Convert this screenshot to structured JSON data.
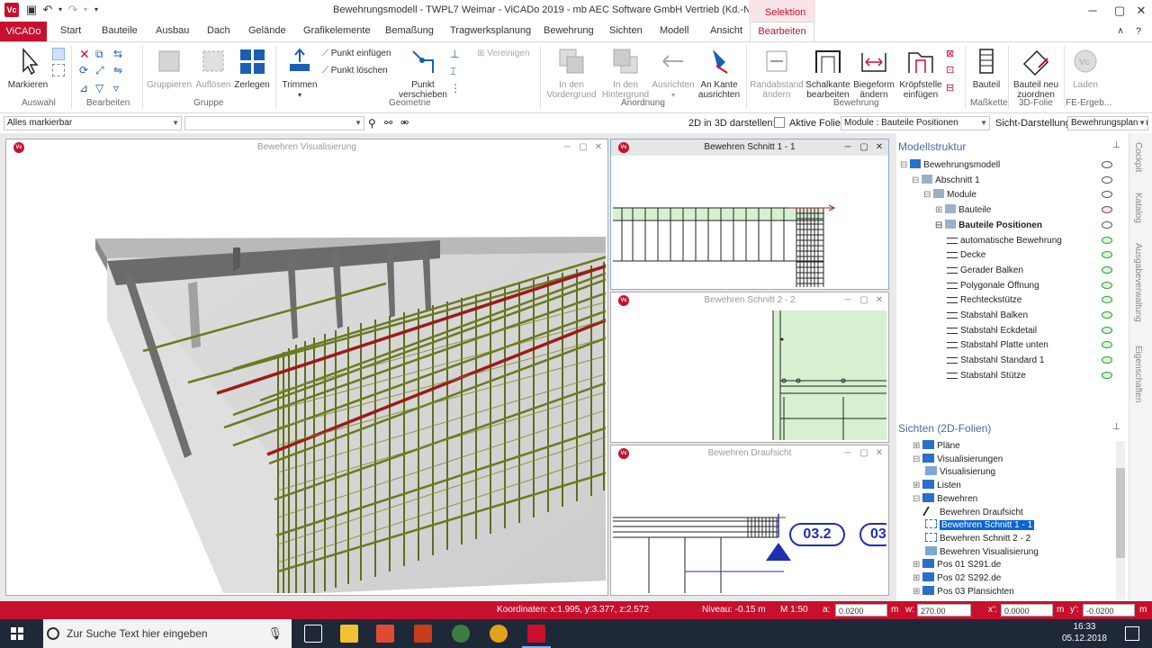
{
  "window": {
    "title": "Bewehrungsmodell - TWPL7 Weimar - ViCADo 2019 - mb AEC Software GmbH Vertrieb (Kd.-Nr. 60000)",
    "context_tab": "Selektion",
    "app_logo": "Vc"
  },
  "ribbon_tabs": [
    "ViCADo",
    "Start",
    "Bauteile",
    "Ausbau",
    "Dach",
    "Gelände",
    "Grafikelemente",
    "Bemaßung",
    "Tragwerksplanung",
    "Bewehrung",
    "Sichten",
    "Modell",
    "Ansicht",
    "Bearbeiten"
  ],
  "ribbon": {
    "groups": {
      "auswahl": "Auswahl",
      "bearbeiten": "Bearbeiten",
      "gruppe": "Gruppe",
      "geometrie": "Geometrie",
      "anordnung": "Anordnung",
      "bewehrung": "Bewehrung",
      "masskette": "Maßkette",
      "folie3d": "3D-Folie",
      "fe": "FE-Ergeb..."
    },
    "markieren": "Markieren",
    "gruppieren": "Gruppieren",
    "aufloesen": "Auflösen",
    "zerlegen": "Zerlegen",
    "trimmen": "Trimmen",
    "punkt_einfuegen": "Punkt einfügen",
    "punkt_loeschen": "Punkt löschen",
    "punkt_verschieben": [
      "Punkt",
      "verschieben"
    ],
    "vereinigen": "Vereinigen",
    "in_den_vordergrund": [
      "In den",
      "Vordergrund"
    ],
    "in_den_hintergrund": [
      "In den",
      "Hintergrund"
    ],
    "ausrichten": "Ausrichten",
    "an_kante_ausrichten": [
      "An Kante",
      "ausrichten"
    ],
    "randabstand_aendern": [
      "Randabstand",
      "ändern"
    ],
    "schalkante_bearbeiten": [
      "Schalkante",
      "bearbeiten"
    ],
    "biegeform_aendern": [
      "Biegeform",
      "ändern"
    ],
    "kroepfstelle_einfuegen": [
      "Kröpfstelle",
      "einfügen"
    ],
    "bauteil": "Bauteil",
    "bauteil_neu_zuordnen": [
      "Bauteil neu",
      "zuordnen"
    ],
    "laden": "Laden"
  },
  "toolrow": {
    "selection_filter": "Alles markierbar",
    "second_combo": "",
    "label_2d_in_3d": "2D in 3D darstellen:",
    "label_aktive_folie": "Aktive Folie:",
    "aktive_folie_value": "Module : Bauteile Positionen",
    "label_sicht": "Sicht-Darstellung:",
    "sicht_value": "Bewehrungsplanung"
  },
  "panes": {
    "vis": "Bewehren Visualisierung",
    "schnitt1": "Bewehren Schnitt 1 - 1",
    "schnitt2": "Bewehren Schnitt 2 - 2",
    "draufsicht": "Bewehren Draufsicht",
    "pos_label_1": "03.2",
    "pos_label_2": "03"
  },
  "modellstruktur": {
    "title": "Modellstruktur",
    "items": [
      {
        "label": "Bewehrungsmodell"
      },
      {
        "label": "Abschnitt 1"
      },
      {
        "label": "Module"
      },
      {
        "label": "Bauteile"
      },
      {
        "label": "Bauteile Positionen"
      },
      {
        "label": "automatische Bewehrung"
      },
      {
        "label": "Decke"
      },
      {
        "label": "Gerader Balken"
      },
      {
        "label": "Polygonale Öffnung"
      },
      {
        "label": "Rechteckstütze"
      },
      {
        "label": "Stabstahl Balken"
      },
      {
        "label": "Stabstahl Eckdetail"
      },
      {
        "label": "Stabstahl Platte unten"
      },
      {
        "label": "Stabstahl Standard 1"
      },
      {
        "label": "Stabstahl Stütze"
      }
    ]
  },
  "sichten": {
    "title": "Sichten (2D-Folien)",
    "items": [
      {
        "label": "Pläne"
      },
      {
        "label": "Visualisierungen"
      },
      {
        "label": "Visualisierung"
      },
      {
        "label": "Listen"
      },
      {
        "label": "Bewehren"
      },
      {
        "label": "Bewehren Draufsicht"
      },
      {
        "label": "Bewehren Schnitt 1 - 1"
      },
      {
        "label": "Bewehren Schnitt 2 - 2"
      },
      {
        "label": "Bewehren Visualisierung"
      },
      {
        "label": "Pos 01 S291.de"
      },
      {
        "label": "Pos 02 S292.de"
      },
      {
        "label": "Pos 03 Plansichten"
      }
    ]
  },
  "side_tabs": [
    "Cockpit",
    "Katalog",
    "Ausgabeverwaltung",
    "Eigenschaften"
  ],
  "statusbar": {
    "koordinaten": "Koordinaten: x:1.995, y:3.377, z:2.572",
    "niveau": "Niveau: -0.15 m",
    "massstab": "M 1:50",
    "a_label": "a:",
    "a_value": "0.0200",
    "m1": "m",
    "w_label": "w:",
    "w_value": "270.00",
    "x_label": "x':",
    "x_value": "0.0000",
    "m2": "m",
    "y_label": "y':",
    "y_value": "-0.0200",
    "m3": "m"
  },
  "taskbar": {
    "search_placeholder": "Zur Suche Text hier eingeben",
    "time": "16:33",
    "date": "05.12.2018"
  },
  "colors": {
    "brand_red": "#c8102e",
    "rebar_green": "#5f6e1e",
    "selection_blue": "#0a64d6"
  }
}
